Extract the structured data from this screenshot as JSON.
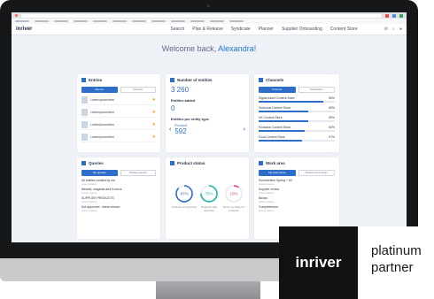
{
  "app": {
    "logo": "inriver"
  },
  "nav": {
    "items": [
      "Search",
      "Plan & Release",
      "Syndicate",
      "Planner",
      "Supplier Onboarding",
      "Content Store"
    ]
  },
  "welcome": {
    "greeting": "Welcome back,",
    "user": "Alexandra!"
  },
  "entries": {
    "title": "Entries",
    "tabs": [
      "Recent",
      "Favorite"
    ],
    "rows": [
      "Lorem ipsum item",
      "Lorem ipsum item",
      "Lorem ipsum item",
      "Lorem ipsum item"
    ]
  },
  "entities": {
    "title": "Number of entities",
    "count": "3 260",
    "added_label": "Entities added",
    "added_value": "0",
    "per_type_label": "Entities per entity type",
    "type_name": "Product",
    "type_count": "592"
  },
  "channels": {
    "title": "Channels",
    "tabs": [
      "Channel",
      "Publication"
    ],
    "rows": [
      {
        "name": "Digital Asset Content Store",
        "pct": "85%",
        "fill": 0.85
      },
      {
        "name": "Technical Content Store",
        "pct": "65%",
        "fill": 0.65
      },
      {
        "name": "UK Content Store",
        "pct": "65%",
        "fill": 0.65
      },
      {
        "name": "Footwear Content Store",
        "pct": "60%",
        "fill": 0.6
      },
      {
        "name": "Food Content Store",
        "pct": "57%",
        "fill": 0.57
      }
    ]
  },
  "queries": {
    "title": "Queries",
    "tabs": [
      "My queries",
      "Shared queries"
    ],
    "items": [
      {
        "name": "All entities created by me",
        "sub": "Lorem ipsum"
      },
      {
        "name": "Newest, magenta and in stock",
        "sub": "Lorem ipsum"
      },
      {
        "name": "SUPPLIER PRODUCTS",
        "sub": "Lorem ipsum"
      },
      {
        "name": "Not approved - latest version",
        "sub": "Lorem ipsum"
      }
    ]
  },
  "product_status": {
    "title": "Product status",
    "rings": [
      {
        "pct": "87%",
        "label": "Products at intermed.",
        "fill": 0.87,
        "color": "#2e6ecb"
      },
      {
        "pct": "75%",
        "label": "Products with accuracy",
        "fill": 0.75,
        "color": "#1fb5a8"
      },
      {
        "pct": "10%",
        "label": "Items not linked to products",
        "fill": 0.1,
        "color": "#d0478a"
      }
    ]
  },
  "work_area": {
    "title": "Work area",
    "tabs": [
      "My work areas",
      "Shared work areas"
    ],
    "items": [
      {
        "name": "Summertime Spring + 60",
        "sub": "Lorem ipsum"
      },
      {
        "name": "Supplier review",
        "sub": "Lorem ipsum"
      },
      {
        "name": "Basics",
        "sub": "Lorem ipsum"
      },
      {
        "name": "Completeness",
        "sub": "Lorem ipsum"
      }
    ]
  },
  "badge": {
    "brand": "inriver",
    "line1": "platinum",
    "line2": "partner"
  },
  "colors": {
    "accent": "#2e6ecb",
    "brand_dark": "#111111"
  }
}
